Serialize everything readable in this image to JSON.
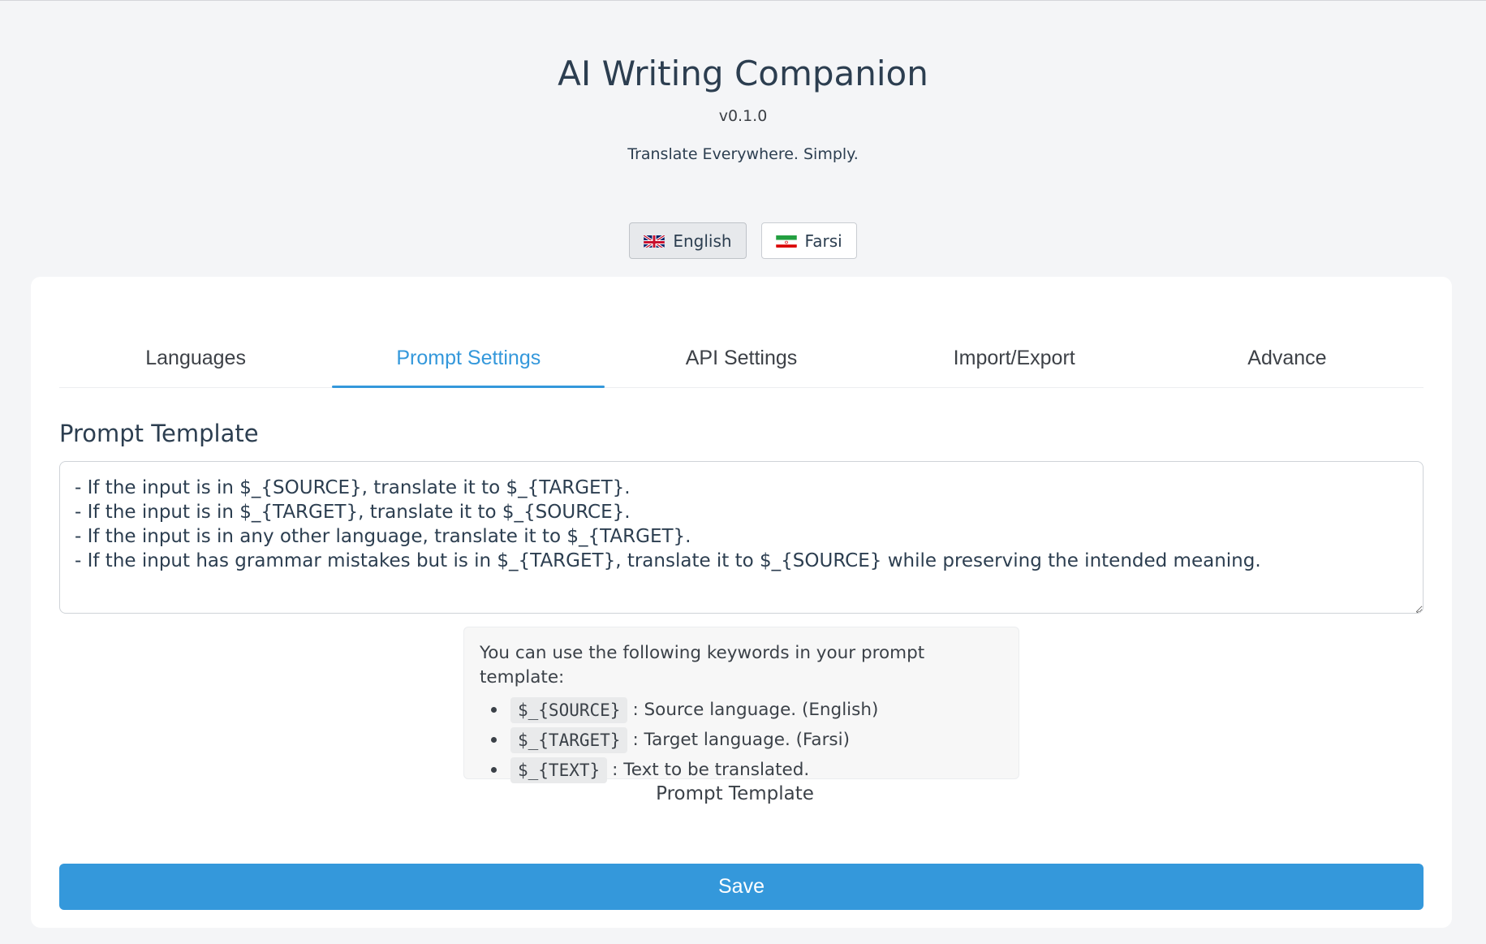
{
  "header": {
    "title": "AI Writing Companion",
    "version": "v0.1.0",
    "tagline": "Translate Everywhere. Simply."
  },
  "ui_language": {
    "options": [
      {
        "label": "English",
        "flag": "uk-flag-icon",
        "selected": true
      },
      {
        "label": "Farsi",
        "flag": "iran-flag-icon",
        "selected": false
      }
    ]
  },
  "tabs": [
    {
      "label": "Languages",
      "active": false
    },
    {
      "label": "Prompt Settings",
      "active": true
    },
    {
      "label": "API Settings",
      "active": false
    },
    {
      "label": "Import/Export",
      "active": false
    },
    {
      "label": "Advance",
      "active": false
    }
  ],
  "prompt": {
    "section_title": "Prompt Template",
    "lines": [
      "- If the input is in $_{SOURCE}, translate it to $_{TARGET}.",
      "- If the input is in $_{TARGET}, translate it to $_{SOURCE}.",
      "- If the input is in any other language, translate it to $_{TARGET}.",
      "- If the input has grammar mistakes but is in $_{TARGET}, translate it to $_{SOURCE} while preserving the intended meaning."
    ],
    "help_intro": "You can use the following keywords in your prompt template:",
    "keywords": [
      {
        "key": "$_{SOURCE}",
        "desc": ": Source language. (English)"
      },
      {
        "key": "$_{TARGET}",
        "desc": ": Target language. (Farsi)"
      },
      {
        "key": "$_{TEXT}",
        "desc": ": Text to be translated."
      }
    ],
    "caption": "Prompt Template"
  },
  "actions": {
    "save_label": "Save"
  },
  "colors": {
    "accent": "#3498db",
    "background": "#f4f5f7",
    "card": "#ffffff"
  }
}
